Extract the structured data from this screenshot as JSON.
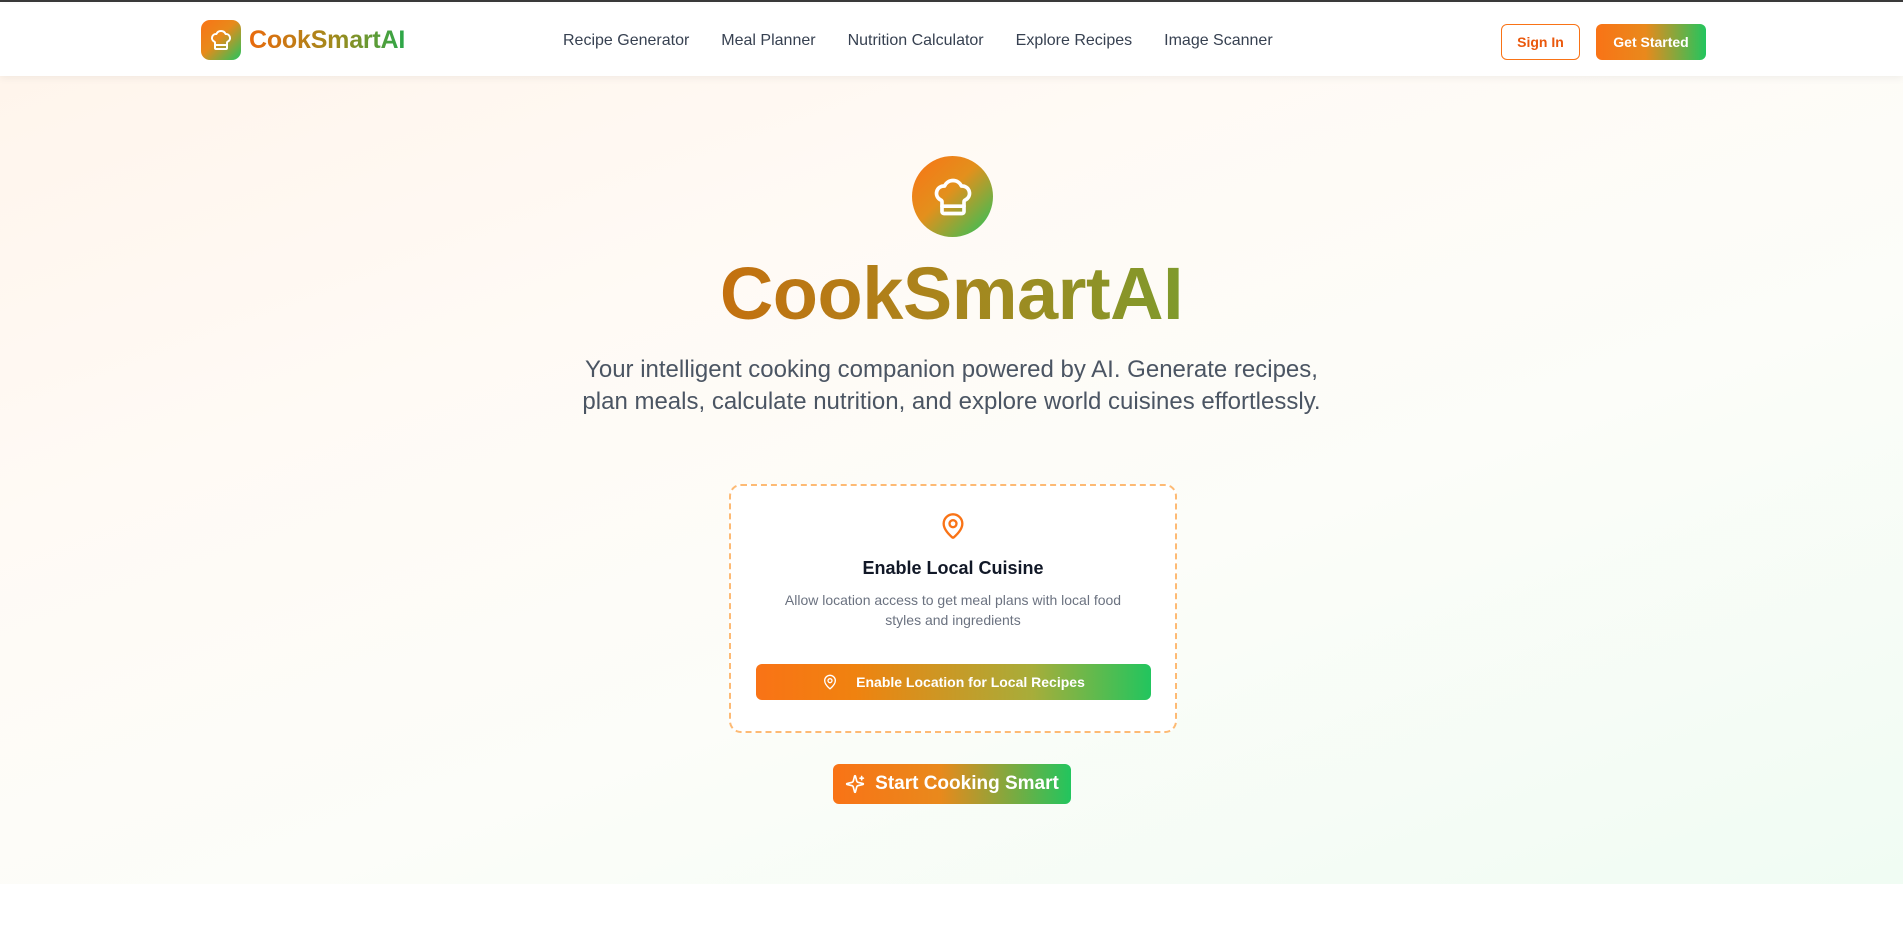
{
  "brand": {
    "name": "CookSmartAI",
    "icon": "chef-hat-icon"
  },
  "nav": {
    "links": [
      "Recipe Generator",
      "Meal Planner",
      "Nutrition Calculator",
      "Explore Recipes",
      "Image Scanner"
    ],
    "sign_in": "Sign In",
    "get_started": "Get Started"
  },
  "hero": {
    "title": "CookSmartAI",
    "subtitle": "Your intelligent cooking companion powered by AI. Generate recipes, plan meals, calculate nutrition, and explore world cuisines effortlessly.",
    "cta": "Start Cooking Smart",
    "cta_icon": "sparkles-icon"
  },
  "location_card": {
    "icon": "map-pin-icon",
    "title": "Enable Local Cuisine",
    "description": "Allow location access to get meal plans with local food styles and ingredients",
    "button": "Enable Location for Local Recipes"
  },
  "colors": {
    "orange": "#f97316",
    "green": "#22c55e",
    "text_dark": "#111827",
    "text_muted": "#6b7280"
  }
}
